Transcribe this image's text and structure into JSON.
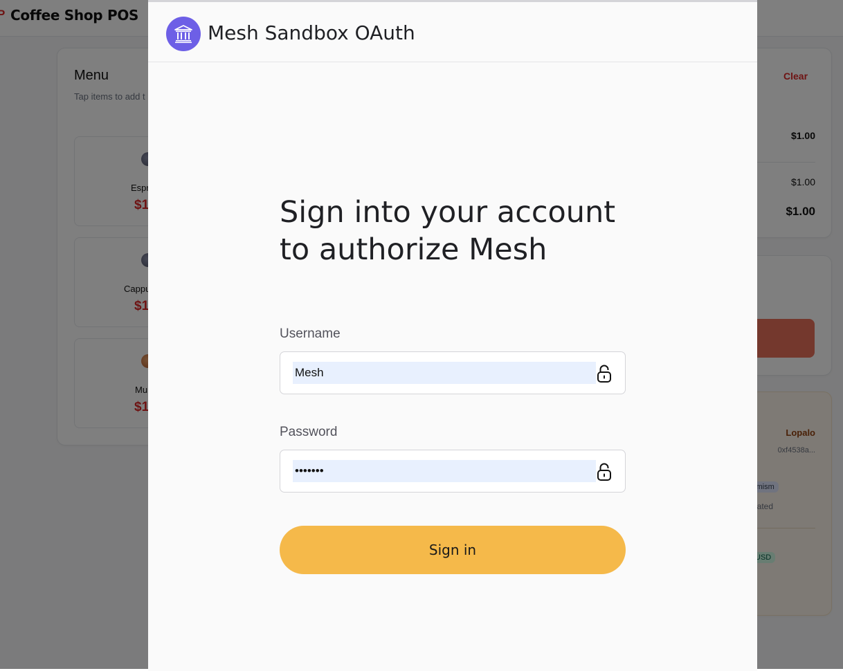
{
  "app": {
    "title": "Coffee Shop POS",
    "menu": {
      "title": "Menu",
      "subtitle": "Tap items to add t",
      "items": [
        {
          "name": "Espr",
          "price": "$1"
        },
        {
          "name": "Cappu",
          "price": "$1"
        },
        {
          "name": "Mu",
          "price": "$1"
        }
      ]
    },
    "order": {
      "clear_label": "Clear",
      "line_price": "$1.00",
      "subtotal": "$1.00",
      "total": "$1.00"
    },
    "wallet": {
      "name": "Lopalo",
      "address": "0xf4538a...",
      "network": "timism",
      "updated": "dated",
      "currency": "USD"
    }
  },
  "modal": {
    "title": "Mesh Sandbox OAuth",
    "logo_icon": "bank-icon",
    "heading": "Sign into your account to authorize Mesh",
    "username": {
      "label": "Username",
      "value": "Mesh"
    },
    "password": {
      "label": "Password",
      "value": "•••••••"
    },
    "submit_label": "Sign in",
    "accent_color": "#6d5fe6",
    "button_color": "#f5b94a"
  }
}
